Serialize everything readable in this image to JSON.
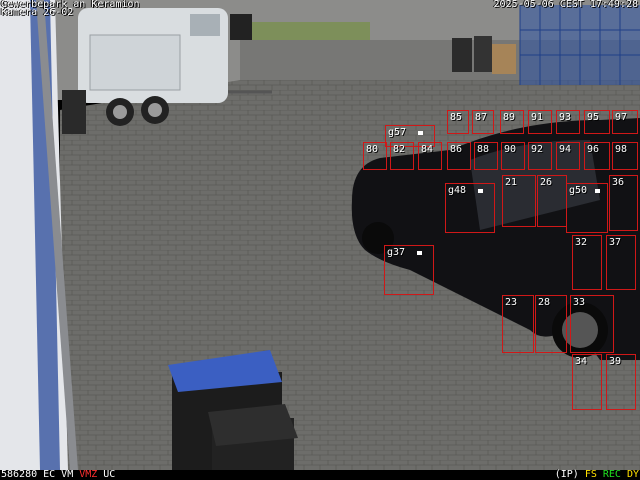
{
  "osd": {
    "title": "Gewerbepark an Keramion",
    "camera": "Kamera 26-02",
    "datetime": "2025-05-06 CEST 17:49:28"
  },
  "status": {
    "code": "586280",
    "flags": [
      {
        "text": "EC",
        "color": "#ffffff"
      },
      {
        "text": "VM",
        "color": "#ffffff"
      },
      {
        "text": "VMZ",
        "color": "#ff3030"
      },
      {
        "text": "UC",
        "color": "#ffffff"
      }
    ],
    "right_flags": [
      {
        "text": "(IP)",
        "color": "#ffffff"
      },
      {
        "text": "FS",
        "color": "#ffe000"
      },
      {
        "text": "REC",
        "color": "#20e020"
      },
      {
        "text": "DY",
        "color": "#ffe000"
      }
    ]
  },
  "detections": [
    "85",
    "87",
    "89",
    "91",
    "93",
    "95",
    "97",
    "g57",
    "80",
    "82",
    "84",
    "86",
    "88",
    "90",
    "92",
    "94",
    "96",
    "98",
    "g48",
    "21",
    "26",
    "g50",
    "36",
    "g37",
    "32",
    "37",
    "23",
    "28",
    "33",
    "34",
    "39"
  ],
  "accent": {
    "box": "#d01818"
  }
}
